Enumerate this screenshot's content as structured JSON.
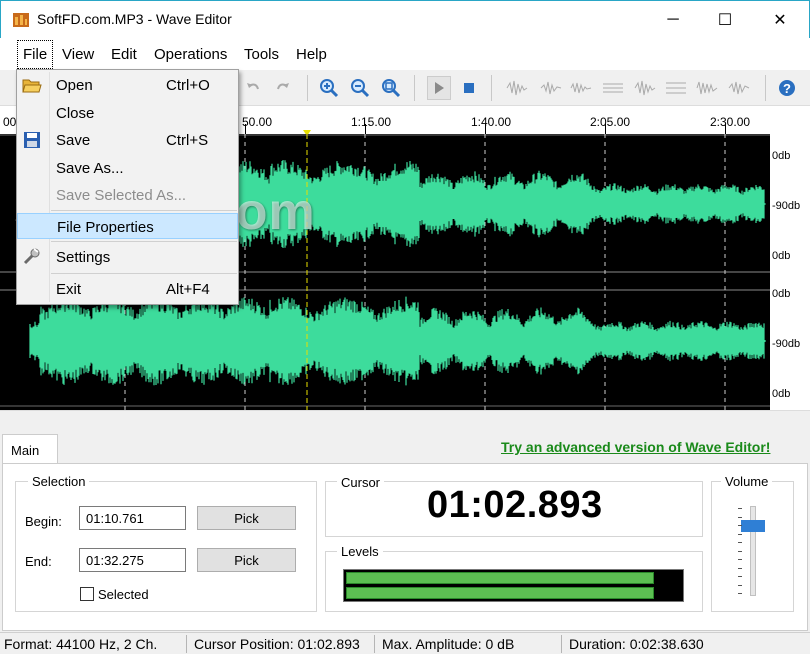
{
  "window": {
    "title": "SoftFD.com.MP3 - Wave Editor",
    "minimize_glyph": "─",
    "maximize_glyph": "☐",
    "close_glyph": "✕"
  },
  "menubar": {
    "items": [
      "File",
      "View",
      "Edit",
      "Operations",
      "Tools",
      "Help"
    ]
  },
  "file_menu": {
    "items": [
      {
        "label": "Open",
        "accel": "Ctrl+O",
        "icon": "folder-open-icon",
        "enabled": true
      },
      {
        "label": "Close",
        "accel": "",
        "enabled": true
      },
      {
        "label": "Save",
        "accel": "Ctrl+S",
        "icon": "floppy-disk-icon",
        "enabled": true
      },
      {
        "label": "Save As...",
        "accel": "",
        "enabled": true
      },
      {
        "label": "Save Selected As...",
        "accel": "",
        "enabled": false
      },
      {
        "label": "File Properties",
        "accel": "",
        "enabled": true,
        "highlighted": true
      },
      {
        "label": "Settings",
        "accel": "",
        "icon": "wrench-icon",
        "enabled": true
      },
      {
        "label": "Exit",
        "accel": "Alt+F4",
        "enabled": true
      }
    ]
  },
  "timeline": {
    "ticks": [
      "00:",
      "50.00",
      "1:15.00",
      "1:40.00",
      "2:05.00",
      "2:30.00"
    ]
  },
  "db_scale": {
    "labels": [
      "0db",
      "-90db",
      "0db",
      "0db",
      "-90db",
      "0db"
    ]
  },
  "watermark": "SoftFD.com",
  "panel": {
    "tab_label": "Main",
    "advert_link": "Try an advanced version of Wave Editor!",
    "selection": {
      "title": "Selection",
      "begin_label": "Begin:",
      "begin_value": "01:10.761",
      "end_label": "End:",
      "end_value": "01:32.275",
      "pick_label": "Pick",
      "selected_label": "Selected",
      "selected_checked": false
    },
    "cursor": {
      "title": "Cursor",
      "time": "01:02.893"
    },
    "levels": {
      "title": "Levels",
      "left_level": 0.92,
      "right_level": 0.92
    },
    "volume": {
      "title": "Volume",
      "level": 0.82
    }
  },
  "statusbar": {
    "format": "Format: 44100 Hz, 2 Ch.",
    "cursor_position": "Cursor Position: 01:02.893",
    "max_amplitude": "Max. Amplitude: 0 dB",
    "duration": "Duration: 0:02:38.630"
  },
  "colors": {
    "waveform": "#3ddc9c",
    "waveform_bg": "#000000",
    "level_bar": "#5cbf52",
    "link": "#1a8a1a",
    "accent": "#2f7fd5"
  }
}
